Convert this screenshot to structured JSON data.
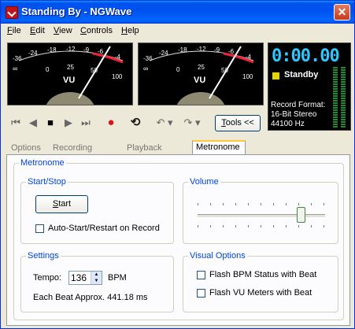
{
  "window": {
    "title": "Standing By - NGWave",
    "close_glyph": "✕"
  },
  "menu": [
    {
      "label": "File",
      "key": "F",
      "rest": "ile"
    },
    {
      "label": "Edit",
      "key": "E",
      "rest": "dit"
    },
    {
      "label": "View",
      "key": "V",
      "rest": "iew"
    },
    {
      "label": "Controls",
      "key": "C",
      "rest": "ontrols"
    },
    {
      "label": "Help",
      "key": "H",
      "rest": "elp"
    }
  ],
  "meters": {
    "vu_label": "VU",
    "scale": [
      "-36",
      "-24",
      "-18",
      "-12",
      "-9",
      "-6",
      "-4",
      "∞",
      "0",
      "25",
      "50",
      "100"
    ]
  },
  "display": {
    "time": "0:00.00",
    "status": "Standby",
    "status_color": "#e6d400",
    "format_label": "Record Format:",
    "format_channels": "16-Bit Stereo",
    "format_rate": "44100 Hz"
  },
  "transport": {
    "tools_label": "Tools <<",
    "tools_key": "T",
    "tools_rest": "ools <<",
    "icons": [
      "rewind-start-icon",
      "rewind-icon",
      "stop-icon",
      "play-icon",
      "fast-forward-icon",
      "record-icon",
      "loop-icon",
      "undo-icon",
      "redo-icon"
    ],
    "record_color": "#e0101a",
    "loop_color": "#1a1a1a"
  },
  "tabs": [
    "Options",
    "Recording Mixer",
    "Playback Mixer",
    "Metronome"
  ],
  "active_tab": "Metronome",
  "metronome": {
    "group_title": "Metronome",
    "start_stop": {
      "title": "Start/Stop",
      "start_button": "Start",
      "start_key": "S",
      "start_rest": "tart",
      "auto_start_label": "Auto-Start/Restart on Record",
      "auto_start_checked": false
    },
    "volume": {
      "title": "Volume",
      "level": 0.88
    },
    "settings": {
      "title": "Settings",
      "tempo_label": "Tempo:",
      "tempo_value": "136",
      "bpm_label": "BPM",
      "beat_text": "Each Beat Approx. 441.18 ms"
    },
    "visual": {
      "title": "Visual Options",
      "flash_bpm_label": "Flash BPM Status with Beat",
      "flash_bpm_checked": false,
      "flash_vu_label": "Flash VU Meters with Beat",
      "flash_vu_checked": false
    }
  }
}
